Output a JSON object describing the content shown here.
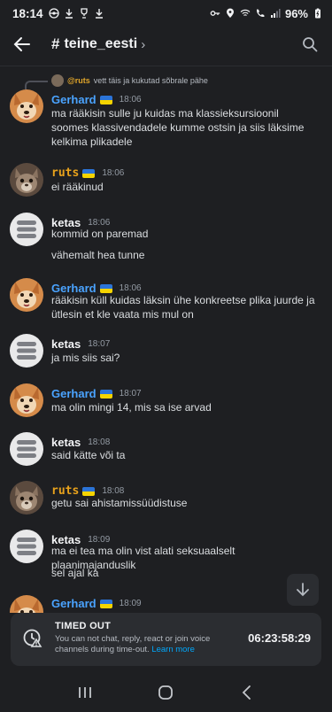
{
  "statusbar": {
    "time": "18:14",
    "battery": "96%"
  },
  "header": {
    "hash": "#",
    "channel": "teine_eesti"
  },
  "reply": {
    "author": "@ruts",
    "text": "vett täis ja kukutad sõbrale pähe"
  },
  "messages": [
    {
      "author": "Gerhard",
      "time": "18:06",
      "color": "#4aa3ff",
      "lines": [
        "ma rääkisin sulle ju kuidas ma klassieksursioonil soomes klassivendadele kumme ostsin ja siis läksime kelkima plikadele"
      ]
    },
    {
      "author": "ruts",
      "time": "18:06",
      "color": "#e8a21c",
      "lines": [
        "ei rääkinud"
      ]
    },
    {
      "author": "ketas",
      "time": "18:06",
      "color": "#f2f3f5",
      "lines": [
        "kommid on paremad",
        "vähemalt hea tunne"
      ]
    },
    {
      "author": "Gerhard",
      "time": "18:06",
      "color": "#4aa3ff",
      "lines": [
        "rääkisin küll kuidas läksin ühe konkreetse plika juurde ja ütlesin et kle vaata mis mul on"
      ]
    },
    {
      "author": "ketas",
      "time": "18:07",
      "color": "#f2f3f5",
      "lines": [
        "ja mis siis sai?"
      ]
    },
    {
      "author": "Gerhard",
      "time": "18:07",
      "color": "#4aa3ff",
      "lines": [
        "ma olin mingi 14, mis sa ise arvad"
      ]
    },
    {
      "author": "ketas",
      "time": "18:08",
      "color": "#f2f3f5",
      "lines": [
        "said kätte või ta"
      ]
    },
    {
      "author": "ruts",
      "time": "18:08",
      "color": "#e8a21c",
      "lines": [
        "getu sai ahistamissüüdistuse"
      ]
    },
    {
      "author": "ketas",
      "time": "18:09",
      "color": "#f2f3f5",
      "lines": [
        "ma ei tea ma olin vist alati seksuaalselt plaanimajanduslik",
        "sel ajal ka"
      ]
    },
    {
      "author": "Gerhard",
      "time": "18:09",
      "color": "#4aa3ff",
      "lines": []
    }
  ],
  "timeout": {
    "title": "TIMED OUT",
    "desc": "You can not chat, reply, react or join voice channels during time-out.",
    "link": "Learn more",
    "timer": "06:23:58:29"
  }
}
